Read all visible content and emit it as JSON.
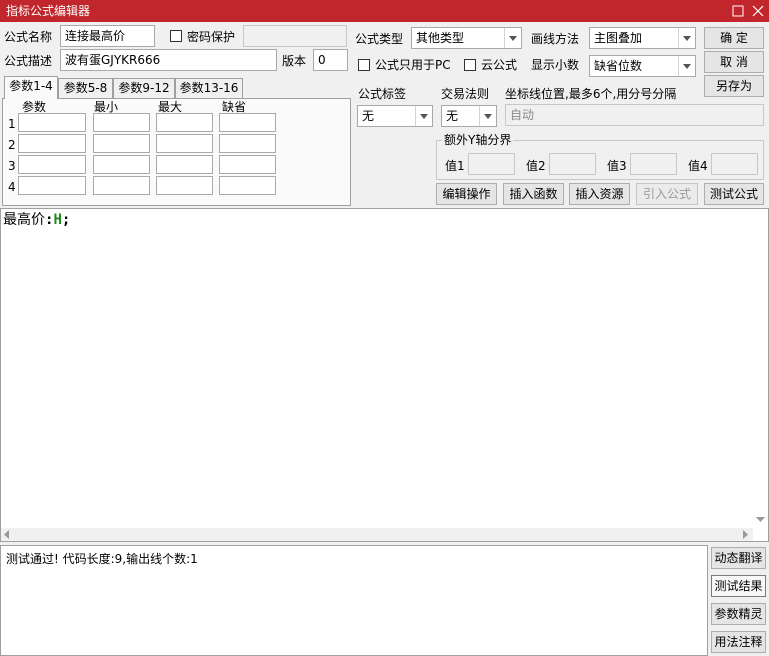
{
  "window": {
    "title": "指标公式编辑器",
    "colors": {
      "titlebar": "#c0262b",
      "accent_green": "#1e8a1e"
    }
  },
  "form": {
    "name_label": "公式名称",
    "name_value": "连接最高价",
    "password_label": "密码保护",
    "password_checked": false,
    "desc_label": "公式描述",
    "desc_value": "波有蛋GJYKR666",
    "version_label": "版本",
    "version_value": "0",
    "type_label": "公式类型",
    "type_value": "其他类型",
    "pc_only_label": "公式只用于PC",
    "pc_only_checked": false,
    "cloud_label": "云公式",
    "cloud_checked": false,
    "draw_label": "画线方法",
    "draw_value": "主图叠加",
    "decimal_label": "显示小数",
    "decimal_value": "缺省位数",
    "tag_label": "公式标签",
    "tag_value": "无",
    "trade_label": "交易法则",
    "trade_value": "无",
    "axis_label": "坐标线位置,最多6个,用分号分隔",
    "axis_value": "自动",
    "extra_y_label": "额外Y轴分界",
    "values": [
      "值1",
      "值2",
      "值3",
      "值4"
    ]
  },
  "buttons": {
    "ok": "确  定",
    "cancel": "取  消",
    "save_as": "另存为",
    "edit_op": "编辑操作",
    "insert_func": "插入函数",
    "insert_res": "插入资源",
    "import_formula": "引入公式",
    "test_formula": "测试公式"
  },
  "params": {
    "tabs": [
      "参数1-4",
      "参数5-8",
      "参数9-12",
      "参数13-16"
    ],
    "active_tab": 0,
    "headers": [
      "参数",
      "最小",
      "最大",
      "缺省"
    ],
    "rows": [
      "1",
      "2",
      "3",
      "4"
    ]
  },
  "editor": {
    "code_name": "最高价",
    "code_sep": ":",
    "code_func": "H",
    "code_end": ";"
  },
  "output": {
    "text": "测试通过! 代码长度:9,输出线个数:1"
  },
  "side_buttons": [
    "动态翻译",
    "测试结果",
    "参数精灵",
    "用法注释"
  ]
}
